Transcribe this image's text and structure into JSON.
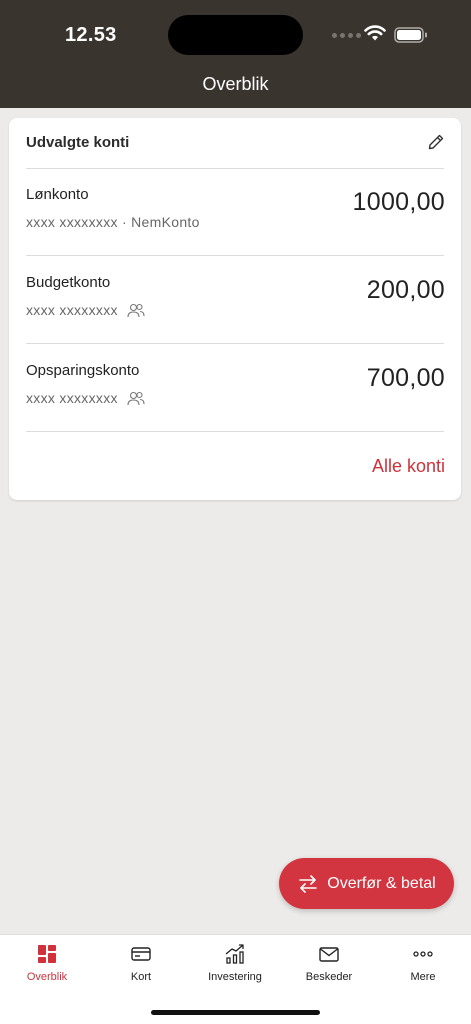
{
  "status_bar": {
    "time": "12.53"
  },
  "header": {
    "title": "Overblik"
  },
  "card": {
    "title": "Udvalgte konti",
    "accounts": [
      {
        "name": "Lønkonto",
        "number": "xxxx xxxxxxxx · NemKonto",
        "amount": "1000,00",
        "shared": false
      },
      {
        "name": "Budgetkonto",
        "number": "xxxx xxxxxxxx",
        "amount": "200,00",
        "shared": true
      },
      {
        "name": "Opsparingskonto",
        "number": "xxxx xxxxxxxx",
        "amount": "700,00",
        "shared": true
      }
    ],
    "all_accounts_link": "Alle konti"
  },
  "fab": {
    "label": "Overfør & betal"
  },
  "tabbar": {
    "tabs": [
      {
        "label": "Overblik",
        "icon": "dashboard-icon",
        "active": true
      },
      {
        "label": "Kort",
        "icon": "card-icon",
        "active": false
      },
      {
        "label": "Investering",
        "icon": "chart-icon",
        "active": false
      },
      {
        "label": "Beskeder",
        "icon": "mail-icon",
        "active": false
      },
      {
        "label": "Mere",
        "icon": "more-icon",
        "active": false
      }
    ]
  },
  "colors": {
    "header": "#3a342f",
    "accent": "#d2313c",
    "background": "#ecebe9"
  }
}
